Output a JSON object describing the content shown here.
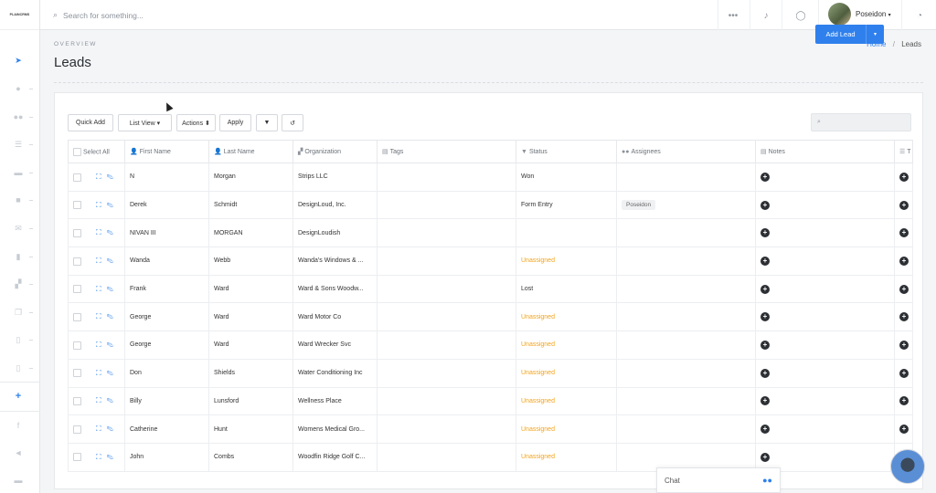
{
  "logo": {
    "text": "PLAINCRMS"
  },
  "topbar": {
    "search_placeholder": "Search for something...",
    "user_name": "Poseidon",
    "user_caret": "▾"
  },
  "header": {
    "overview": "OVERVIEW",
    "title": "Leads",
    "breadcrumb": {
      "home": "Home",
      "sep": "/",
      "current": "Leads"
    },
    "add_button": "Add Lead",
    "add_caret": "▾"
  },
  "toolbar": {
    "quick_add": "Quick Add",
    "list_view": "List View ▾",
    "actions": "Actions ⬍",
    "apply": "Apply",
    "filter_icon": "▼",
    "reset_icon": "↺",
    "search_icon": "⌕"
  },
  "table": {
    "headers": [
      "Select All",
      "First Name",
      "Last Name",
      "Organization",
      "Tags",
      "Status",
      "Assignees",
      "Notes",
      "T"
    ],
    "rows": [
      {
        "first": "N",
        "last": "Morgan",
        "org": "Strips LLC",
        "status": "Won",
        "status_type": "won",
        "assignee": ""
      },
      {
        "first": "Derek",
        "last": "Schmidt",
        "org": "DesignLoud, Inc.",
        "status": "Form Entry",
        "status_type": "form",
        "assignee": "Poseidon"
      },
      {
        "first": "NIVAN III",
        "last": "MORGAN",
        "org": "DesignLoudish",
        "status": "",
        "status_type": "",
        "assignee": ""
      },
      {
        "first": "Wanda",
        "last": "Webb",
        "org": "Wanda's Windows & ...",
        "status": "Unassigned",
        "status_type": "unassigned",
        "assignee": ""
      },
      {
        "first": "Frank",
        "last": "Ward",
        "org": "Ward & Sons Woodw...",
        "status": "Lost",
        "status_type": "lost",
        "assignee": ""
      },
      {
        "first": "George",
        "last": "Ward",
        "org": "Ward Motor Co",
        "status": "Unassigned",
        "status_type": "unassigned",
        "assignee": ""
      },
      {
        "first": "George",
        "last": "Ward",
        "org": "Ward Wrecker Svc",
        "status": "Unassigned",
        "status_type": "unassigned",
        "assignee": ""
      },
      {
        "first": "Don",
        "last": "Shields",
        "org": "Water Conditioning Inc",
        "status": "Unassigned",
        "status_type": "unassigned",
        "assignee": ""
      },
      {
        "first": "Billy",
        "last": "Lunsford",
        "org": "Wellness Place",
        "status": "Unassigned",
        "status_type": "unassigned",
        "assignee": ""
      },
      {
        "first": "Catherine",
        "last": "Hunt",
        "org": "Womens Medical Gro...",
        "status": "Unassigned",
        "status_type": "unassigned",
        "assignee": ""
      },
      {
        "first": "John",
        "last": "Combs",
        "org": "Woodfin Ridge Golf C...",
        "status": "Unassigned",
        "status_type": "unassigned",
        "assignee": ""
      }
    ]
  },
  "chat": {
    "label": "Chat"
  },
  "colors": {
    "accent": "#2f80ed",
    "unassigned": "#f2a31b",
    "dark": "#2c2f33"
  }
}
